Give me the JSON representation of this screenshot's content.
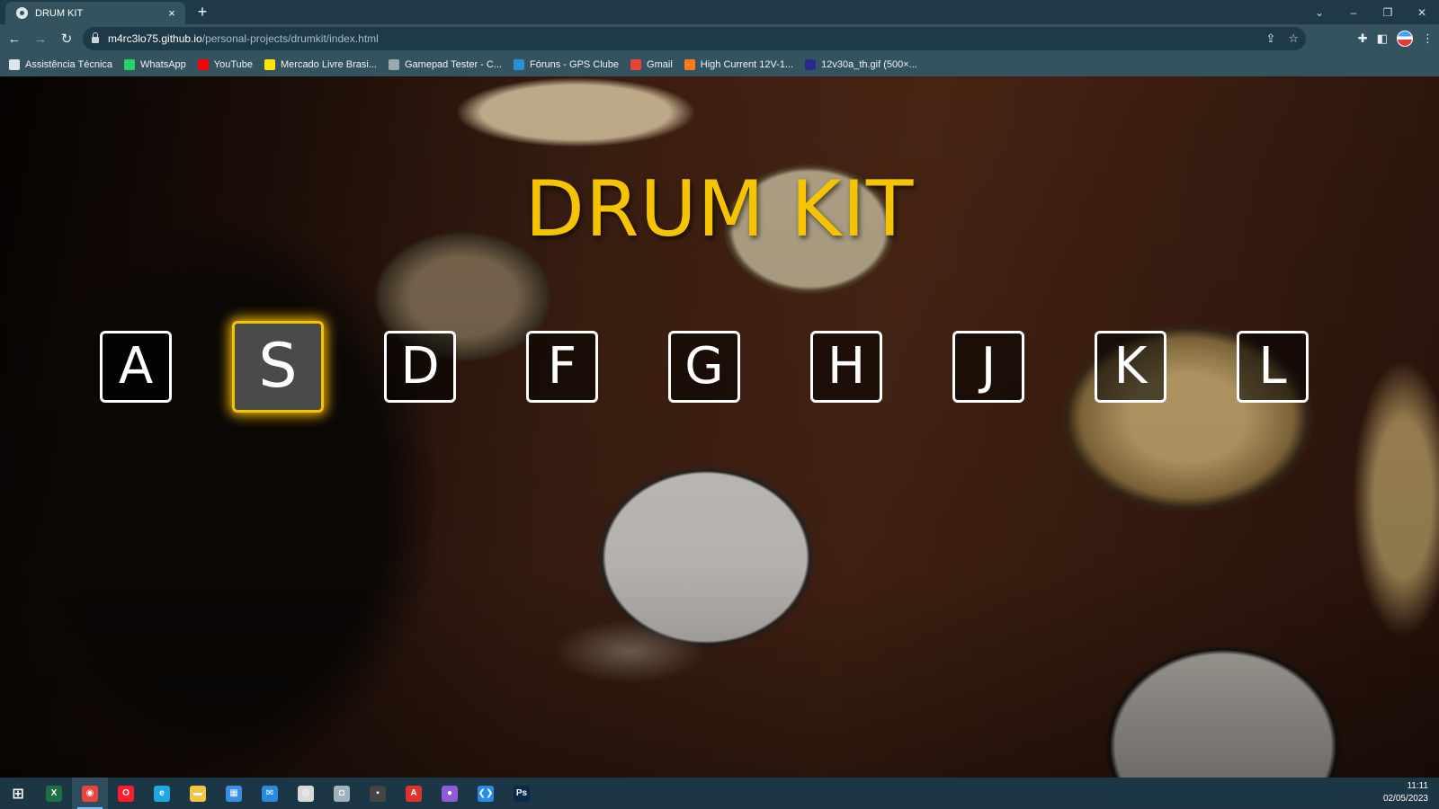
{
  "browser": {
    "tab_title": "DRUM KIT",
    "tab_close": "×",
    "new_tab": "+",
    "window_controls": [
      "⌄",
      "–",
      "❐",
      "✕"
    ],
    "url_domain": "m4rc3lo75.github.io",
    "url_path": "/personal-projects/drumkit/index.html",
    "nav": {
      "back": "←",
      "forward": "→",
      "reload": "↻"
    },
    "omnibox_icons": [
      "share-icon",
      "star-icon"
    ],
    "toolbar_icons": [
      "extensions-icon",
      "sidepanel-icon",
      "profile-avatar",
      "menu-icon"
    ]
  },
  "bookmarks": [
    {
      "label": "Assistência Técnica",
      "icon": "globe-icon",
      "color": "#dfe6ea"
    },
    {
      "label": "WhatsApp",
      "icon": "whatsapp-icon",
      "color": "#25d366"
    },
    {
      "label": "YouTube",
      "icon": "youtube-icon",
      "color": "#ff0000"
    },
    {
      "label": "Mercado Livre Brasi...",
      "icon": "mercadolivre-icon",
      "color": "#ffe600"
    },
    {
      "label": "Gamepad Tester - C...",
      "icon": "gamepad-icon",
      "color": "#9aa7ad"
    },
    {
      "label": "Fóruns - GPS Clube",
      "icon": "gpsclube-icon",
      "color": "#2b8fd6"
    },
    {
      "label": "Gmail",
      "icon": "gmail-icon",
      "color": "#ea4335"
    },
    {
      "label": "High Current 12V-1...",
      "icon": "orange-bookmark-icon",
      "color": "#ff7a1a"
    },
    {
      "label": "12v30a_th.gif (500×...",
      "icon": "image-bookmark-icon",
      "color": "#2a2a8a"
    }
  ],
  "page": {
    "title": "DRUM KIT",
    "active_key": "S",
    "keys": [
      "A",
      "S",
      "D",
      "F",
      "G",
      "H",
      "J",
      "K",
      "L"
    ],
    "title_color": "#f5c400",
    "highlight_color": "#f5b800"
  },
  "taskbar": {
    "apps": [
      {
        "name": "windows-start-icon",
        "color": "#ffffff",
        "glyph": "⊞"
      },
      {
        "name": "excel-icon",
        "color": "#1d7044",
        "glyph": "X"
      },
      {
        "name": "chrome-icon",
        "color": "#e8453c",
        "glyph": "◉",
        "active": true
      },
      {
        "name": "opera-icon",
        "color": "#ff1b2d",
        "glyph": "O"
      },
      {
        "name": "edge-icon",
        "color": "#1fa7e0",
        "glyph": "e"
      },
      {
        "name": "file-explorer-icon",
        "color": "#f4c542",
        "glyph": "▬"
      },
      {
        "name": "store-icon",
        "color": "#3a8ee6",
        "glyph": "▦"
      },
      {
        "name": "mail-icon",
        "color": "#2a8ae0",
        "glyph": "✉"
      },
      {
        "name": "obs-icon",
        "color": "#d9d9d9",
        "glyph": "◎"
      },
      {
        "name": "camera-icon",
        "color": "#9fb3bf",
        "glyph": "◘"
      },
      {
        "name": "app-icon",
        "color": "#444444",
        "glyph": "▪"
      },
      {
        "name": "acrobat-icon",
        "color": "#e0312c",
        "glyph": "A"
      },
      {
        "name": "github-icon",
        "color": "#8e5cd9",
        "glyph": "●"
      },
      {
        "name": "vscode-icon",
        "color": "#2a8ce8",
        "glyph": "❮❯"
      },
      {
        "name": "photoshop-icon",
        "color": "#0a2a4a",
        "glyph": "Ps"
      }
    ],
    "time": "11:11",
    "date": "02/05/2023"
  }
}
